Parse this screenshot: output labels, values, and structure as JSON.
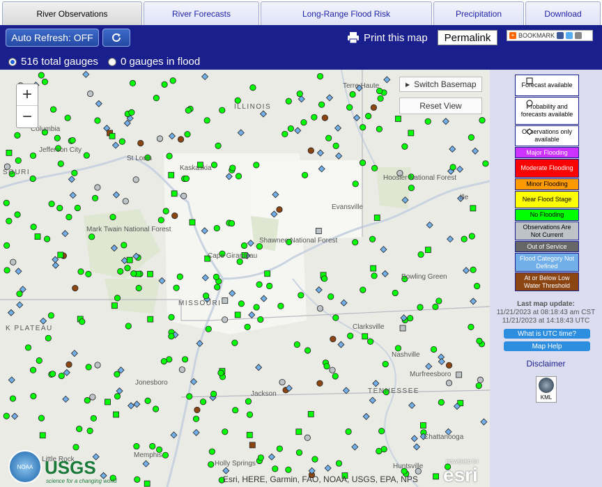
{
  "tabs": [
    {
      "label": "River Observations",
      "active": true
    },
    {
      "label": "River Forecasts",
      "active": false
    },
    {
      "label": "Long-Range Flood Risk",
      "active": false
    },
    {
      "label": "Precipitation",
      "active": false
    },
    {
      "label": "Download",
      "active": false
    }
  ],
  "toolbar": {
    "auto_refresh": "Auto Refresh: OFF",
    "refresh_icon": "refresh-icon",
    "print": "Print this map",
    "permalink": "Permalink",
    "bookmark": "BOOKMARK",
    "radio_total": "516 total gauges",
    "radio_flood": "0 gauges in flood"
  },
  "map": {
    "zoom_in": "+",
    "zoom_out": "−",
    "switch_basemap": "Switch Basemap",
    "reset_view": "Reset View",
    "attribution": "Esri, HERE, Garmin, FAO, NOAA, USGS, EPA, NPS",
    "powered_by": "POWERED BY",
    "esri": "esri",
    "usgs": "USGS",
    "usgs_tagline": "science for a changing world",
    "noaa": "NOAA",
    "places": [
      "Terre Haute",
      "ILLINOIS",
      "Columbia",
      "Jefferson City",
      "SOURI",
      "St Louis",
      "Kaskaskia",
      "Mark Twain National Forest",
      "Evansville",
      "Hoosier National Forest",
      "Shawnee National Forest",
      "Cape Girardeau",
      "MISSOURI",
      "Bowling Green",
      "Clarksville",
      "Nashville",
      "Jonesboro",
      "Jackson",
      "Murfreesboro",
      "TENNESSEE",
      "Memphis",
      "Chattanooga",
      "Huntsville",
      "Holly Springs",
      "Little Rock",
      "K PLATEAU",
      "ille"
    ]
  },
  "legend": {
    "forecast": "Forecast available",
    "probability": "Probability and forecasts available",
    "observations": "Observations only available",
    "major": "Major Flooding",
    "moderate": "Moderate Flooding",
    "minor": "Minor Flooding",
    "near": "Near Flood Stage",
    "no_flooding": "No Flooding",
    "not_current": "Observations Are Not Current",
    "out_of_service": "Out of Service",
    "not_defined": "Flood Category Not Defined",
    "at_or_below": "At or Below Low Water Threshold",
    "colors": {
      "major": "#cc33ff",
      "moderate": "#ff0000",
      "minor": "#ff9900",
      "near": "#ffff00",
      "no_flooding": "#00ff00",
      "not_current": "#bdc3c7",
      "out_of_service": "#666666",
      "not_defined": "#72afe9",
      "at_or_below": "#8b4513"
    },
    "last_update_label": "Last map update:",
    "last_update_cst": "11/21/2023 at 08:18:43 am CST",
    "last_update_utc": "11/21/2023 at 14:18:43 UTC",
    "utc_link": "What is UTC time?",
    "help_link": "Map Help",
    "disclaimer": "Disclaimer",
    "kml": "KML"
  }
}
